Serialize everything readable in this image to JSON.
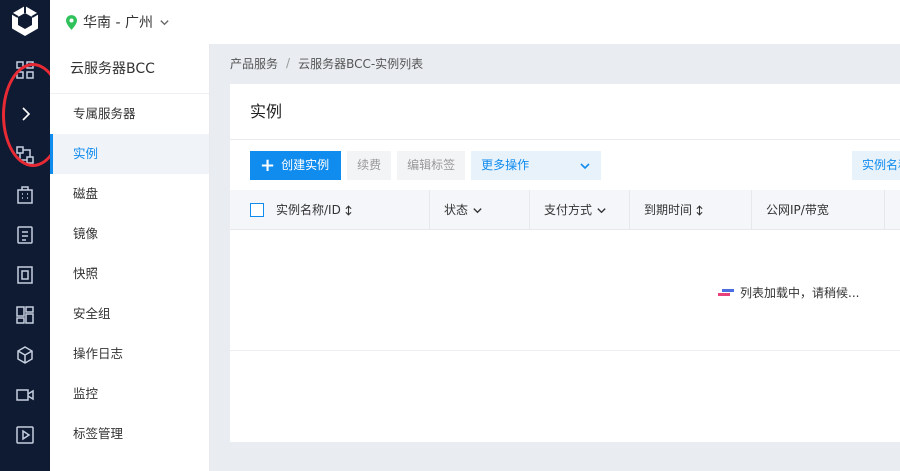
{
  "region": {
    "label": "华南 - 广州"
  },
  "subnav": {
    "title": "云服务器BCC",
    "items": [
      {
        "label": "专属服务器"
      },
      {
        "label": "实例"
      },
      {
        "label": "磁盘"
      },
      {
        "label": "镜像"
      },
      {
        "label": "快照"
      },
      {
        "label": "安全组"
      },
      {
        "label": "操作日志"
      },
      {
        "label": "监控"
      },
      {
        "label": "标签管理"
      }
    ]
  },
  "breadcrumb": {
    "root": "产品服务",
    "separator": "/",
    "current": "云服务器BCC-实例列表"
  },
  "card": {
    "title": "实例"
  },
  "toolbar": {
    "create": "创建实例",
    "renew": "续费",
    "edit_tags": "编辑标签",
    "more": "更多操作",
    "search_label": "实例名称"
  },
  "table": {
    "columns": [
      "实例名称/ID",
      "状态",
      "支付方式",
      "到期时间",
      "公网IP/带宽"
    ],
    "loading": "列表加载中，请稍候..."
  },
  "colors": {
    "accent": "#108cee",
    "rail": "#0e1b33",
    "annotation": "#e82a35"
  }
}
